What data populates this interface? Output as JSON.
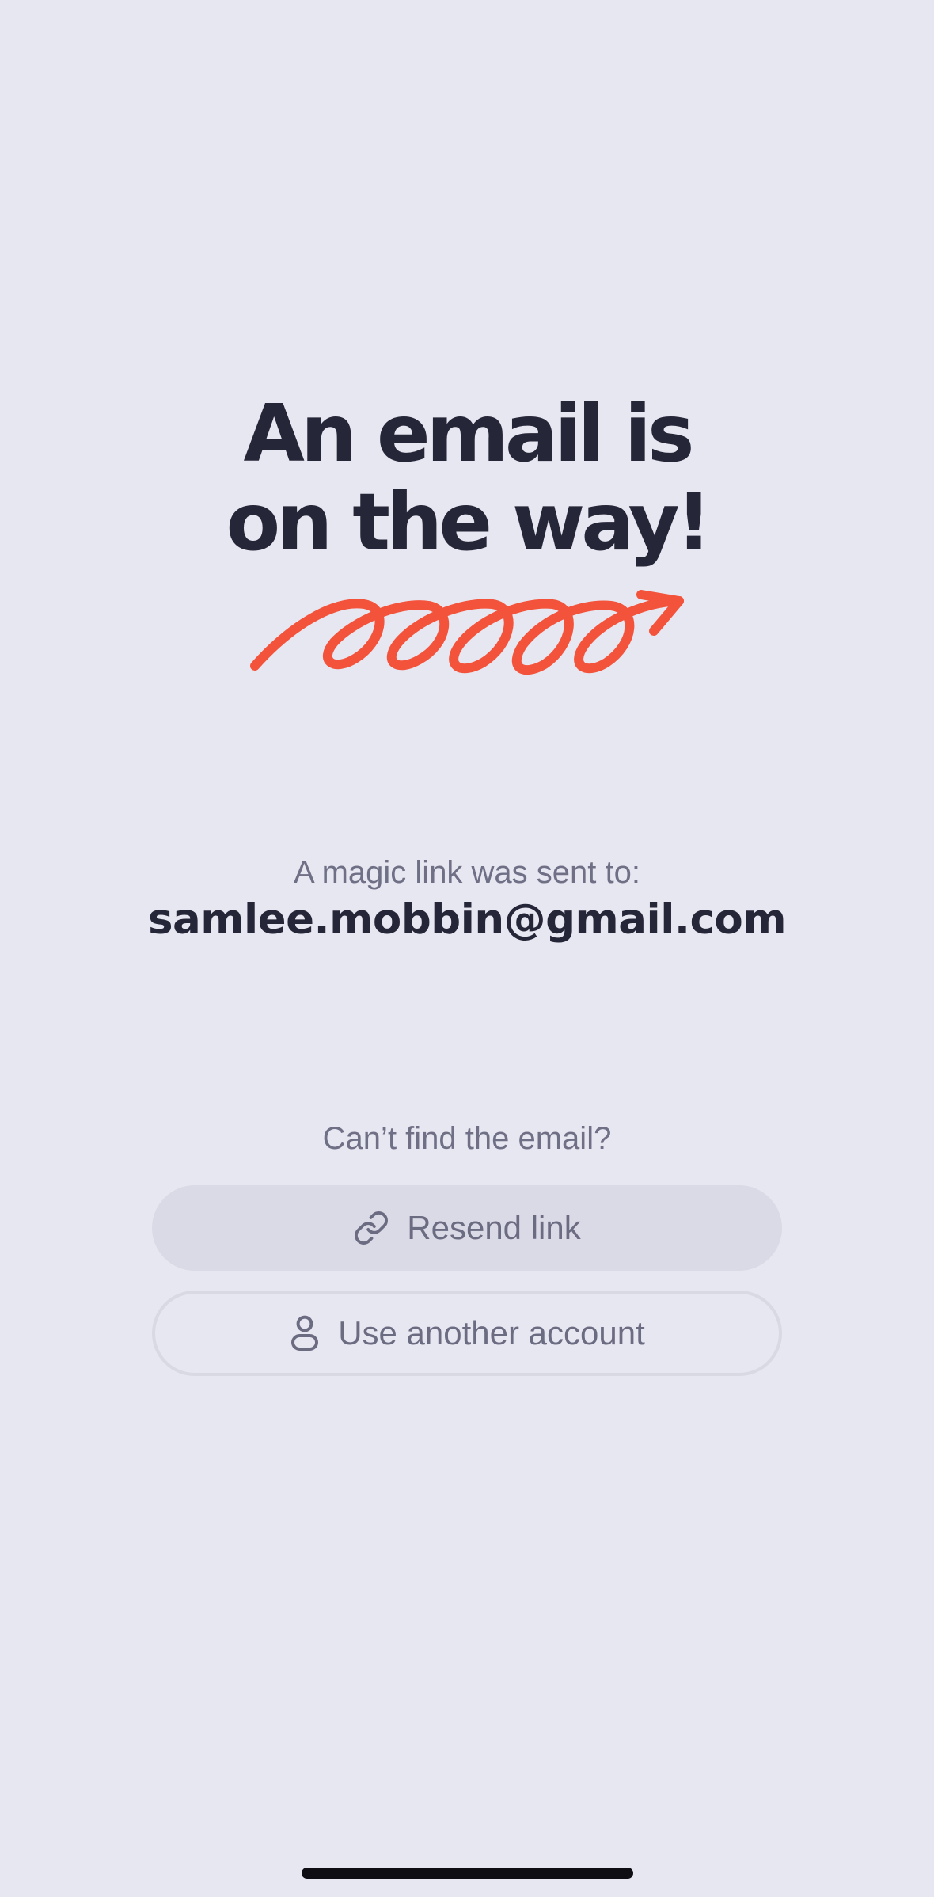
{
  "hero": {
    "title_line1": "An email is",
    "title_line2": "on the way!"
  },
  "decoration": {
    "icon": "squiggle-arrow-icon",
    "color": "#F4533B"
  },
  "confirmation": {
    "label": "A magic link was sent to:",
    "email": "samlee.mobbin@gmail.com"
  },
  "help": {
    "prompt": "Can’t find the email?",
    "resend_label": "Resend link",
    "resend_icon": "link-icon",
    "account_label": "Use another account",
    "account_icon": "user-icon"
  },
  "colors": {
    "background": "#E7E7F1",
    "text_primary": "#262639",
    "text_secondary": "#6F6F86",
    "accent": "#F4533B"
  }
}
